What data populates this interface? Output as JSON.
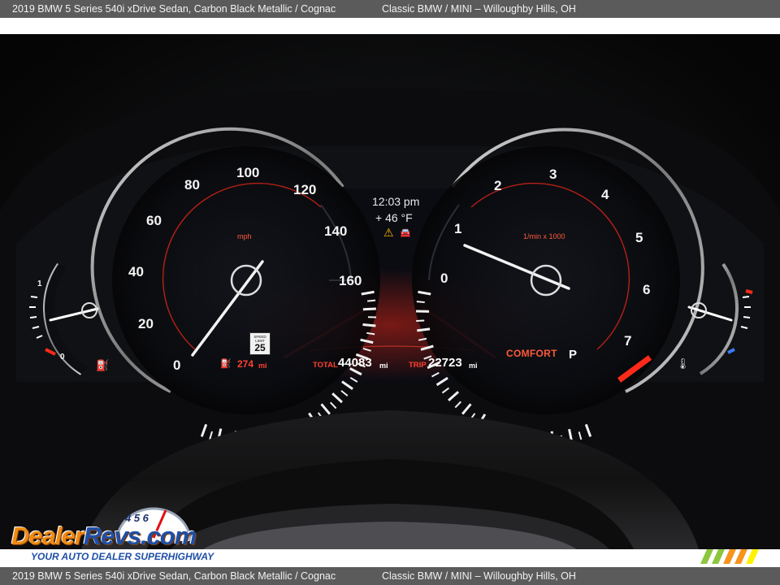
{
  "caption": {
    "model": "2019 BMW 5 Series 540i xDrive Sedan,  Carbon Black Metallic / Cognac",
    "dealer": "Classic BMW / MINI – Willoughby Hills, OH"
  },
  "cluster": {
    "speedometer": {
      "unit": "mph",
      "ticks": [
        "0",
        "20",
        "40",
        "60",
        "80",
        "100",
        "120",
        "140",
        "160"
      ]
    },
    "tachometer": {
      "unit": "1/min x 1000",
      "ticks": [
        "0",
        "1",
        "2",
        "3",
        "4",
        "5",
        "6",
        "7"
      ]
    },
    "clock": "12:03 pm",
    "outside_temp": "+ 46 °F",
    "range": {
      "value": "274",
      "unit": "mi"
    },
    "speed_limit": {
      "title": "SPEED LIMIT",
      "value": "25"
    },
    "total": {
      "label": "TOTAL",
      "value": "44083",
      "unit": "mi"
    },
    "trip": {
      "label": "TRIP",
      "value": "22723",
      "unit": "mi"
    },
    "drive_mode": "COMFORT",
    "gear": "P",
    "fuel_scale": {
      "full": "1",
      "empty": "0"
    },
    "icons": [
      "fuel-pump-icon",
      "warning-triangle-icon",
      "car-sensor-icon",
      "coolant-temp-icon"
    ]
  },
  "watermark": {
    "brand_a": "Dealer",
    "brand_b": "Revs",
    "brand_c": ".com",
    "tagline": "YOUR AUTO DEALER SUPERHIGHWAY",
    "gauge_digits": "4 5 6"
  }
}
